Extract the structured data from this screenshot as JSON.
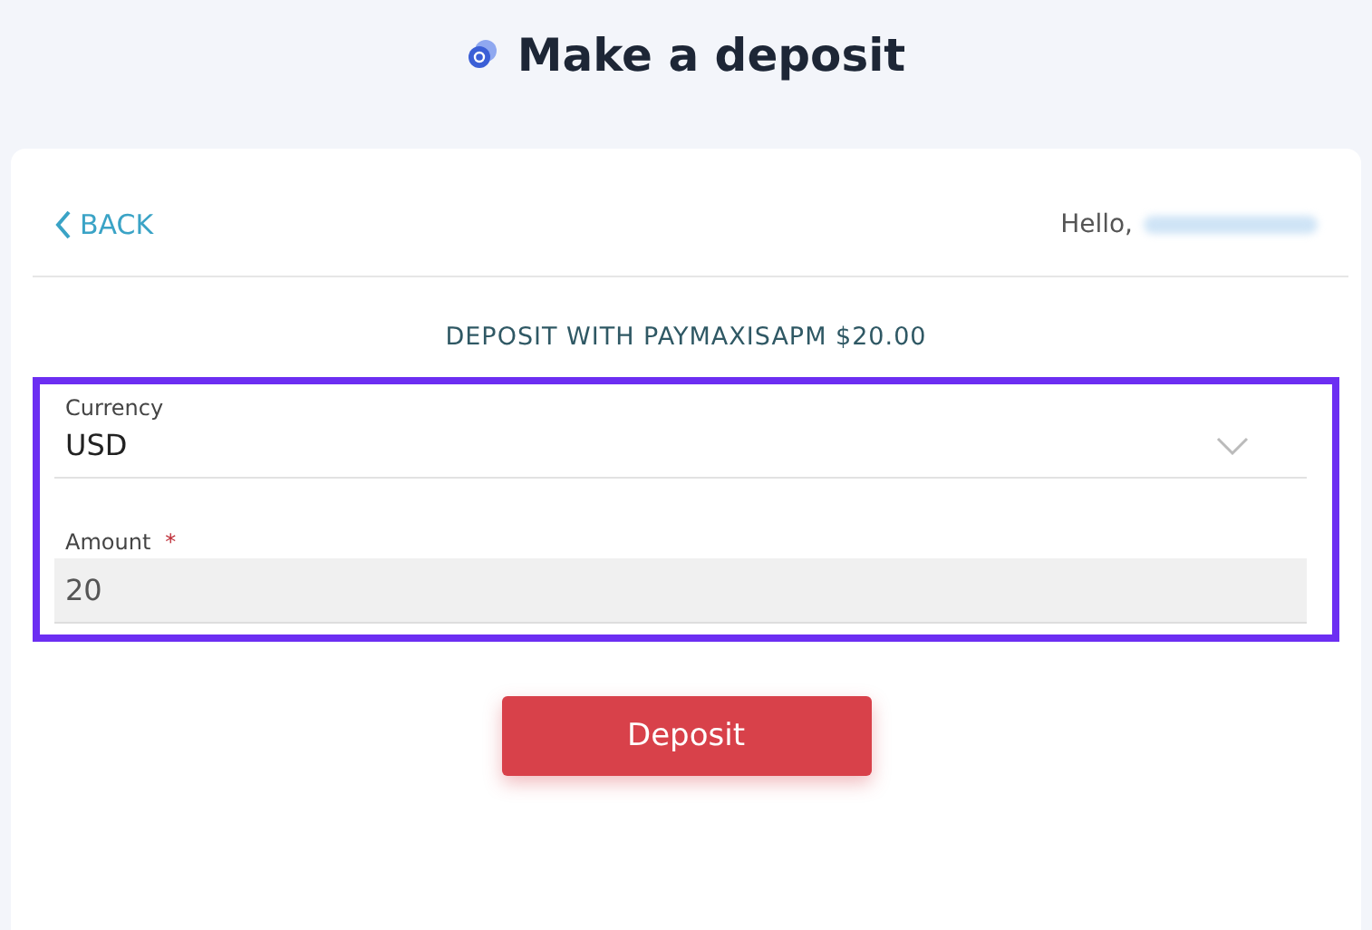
{
  "page_title": "Make a deposit",
  "back_link": {
    "label": "BACK"
  },
  "greeting": {
    "label": "Hello,",
    "name_blurred": true
  },
  "form_heading": "DEPOSIT WITH PAYMAXISAPM $20.00",
  "highlight": true,
  "fields": [
    {
      "kind": "select",
      "label": "Currency",
      "value": "USD",
      "disabled": false
    },
    {
      "kind": "text",
      "label": "Amount",
      "required_mark": "*",
      "value": "20",
      "disabled": true
    }
  ],
  "submit_button": "Deposit"
}
